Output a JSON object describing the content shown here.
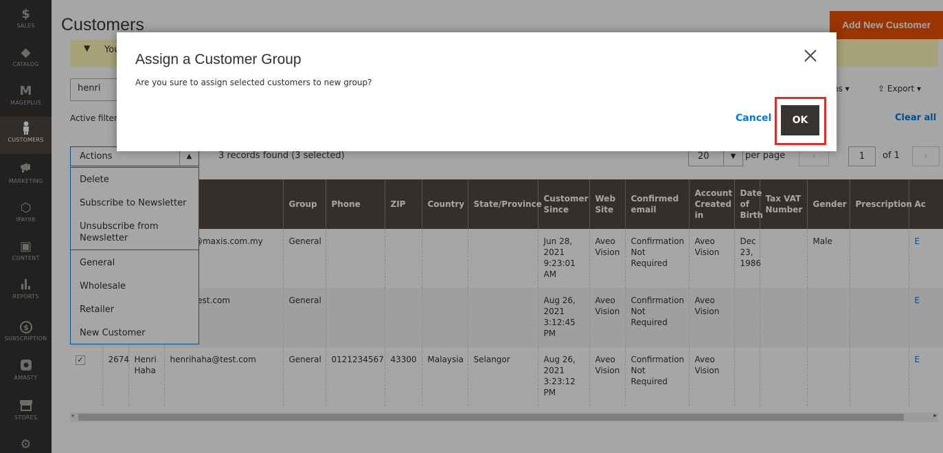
{
  "sidebar": {
    "items": [
      {
        "label": "SALES",
        "icon": "dollar-icon",
        "glyph": "$"
      },
      {
        "label": "CATALOG",
        "icon": "cube-icon",
        "glyph": "◆"
      },
      {
        "label": "MAGEPLUS",
        "icon": "mageplus-icon",
        "glyph": "M"
      },
      {
        "label": "CUSTOMERS",
        "icon": "person-icon",
        "glyph": "👤"
      },
      {
        "label": "MARKETING",
        "icon": "megaphone-icon",
        "glyph": "📢"
      },
      {
        "label": "IPAY88",
        "icon": "hexagon-icon",
        "glyph": "⬡"
      },
      {
        "label": "CONTENT",
        "icon": "layout-icon",
        "glyph": "▣"
      },
      {
        "label": "REPORTS",
        "icon": "bar-chart-icon",
        "glyph": "▮"
      },
      {
        "label": "SUBSCRIPTION",
        "icon": "subscription-icon",
        "glyph": "$"
      },
      {
        "label": "AMASTY",
        "icon": "amasty-icon",
        "glyph": "■"
      },
      {
        "label": "STORES",
        "icon": "store-icon",
        "glyph": "▦"
      },
      {
        "label": "",
        "icon": "gear-icon",
        "glyph": "⚙"
      }
    ]
  },
  "header": {
    "title": "Customers",
    "add_button": "Add New Customer"
  },
  "message": {
    "text": "You"
  },
  "search": {
    "value": "henri"
  },
  "filters": {
    "active_label": "Active filters",
    "clear_all": "Clear all"
  },
  "toolbar": {
    "columns_label": "ns",
    "export_label": "Export",
    "actions_label": "Actions",
    "records_text": "3 records found (3 selected)",
    "per_page_value": "20",
    "per_page_label": "per page",
    "page_number": "1",
    "page_of": "of 1"
  },
  "actions_menu": {
    "items": [
      "Delete",
      "Subscribe to Newsletter",
      "Unsubscribe from Newsletter"
    ],
    "groups": [
      "General",
      "Wholesale",
      "Retailer",
      "New Customer"
    ]
  },
  "grid": {
    "columns": [
      "",
      "",
      "",
      "l",
      "Group",
      "Phone",
      "ZIP",
      "Country",
      "State/Province",
      "Customer Since",
      "Web Site",
      "Confirmed email",
      "Account Created in",
      "Date of Birth",
      "Tax VAT Number",
      "Gender",
      "Prescription",
      "Ac"
    ],
    "rows": [
      {
        "id": "",
        "name": "",
        "email": "aising@maxis.com.my",
        "group": "General",
        "phone": "",
        "zip": "",
        "country": "",
        "state": "",
        "since": "Jun 28, 2021 9:23:01 AM",
        "website": "Aveo Vision",
        "confirmed": "Confirmation Not Required",
        "created_in": "Aveo Vision",
        "dob": "Dec 23, 1986",
        "taxvat": "",
        "gender": "Male",
        "prescription": "",
        "action": "E"
      },
      {
        "id": "",
        "name": "",
        "email": "test@test.com",
        "group": "General",
        "phone": "",
        "zip": "",
        "country": "",
        "state": "",
        "since": "Aug 26, 2021 3:12:45 PM",
        "website": "Aveo Vision",
        "confirmed": "Confirmation Not Required",
        "created_in": "Aveo Vision",
        "dob": "",
        "taxvat": "",
        "gender": "",
        "prescription": "",
        "action": "E"
      },
      {
        "id": "2674",
        "name": "Henri Haha",
        "email": "henrihaha@test.com",
        "group": "General",
        "phone": "0121234567",
        "zip": "43300",
        "country": "Malaysia",
        "state": "Selangor",
        "since": "Aug 26, 2021 3:23:12 PM",
        "website": "Aveo Vision",
        "confirmed": "Confirmation Not Required",
        "created_in": "Aveo Vision",
        "dob": "",
        "taxvat": "",
        "gender": "",
        "prescription": "",
        "action": "E"
      }
    ]
  },
  "modal": {
    "title": "Assign a Customer Group",
    "text": "Are you sure to assign selected customers to new group?",
    "cancel": "Cancel",
    "ok": "OK"
  },
  "colors": {
    "accent": "#eb5202",
    "link": "#007bdb",
    "highlight": "#e02b27"
  }
}
